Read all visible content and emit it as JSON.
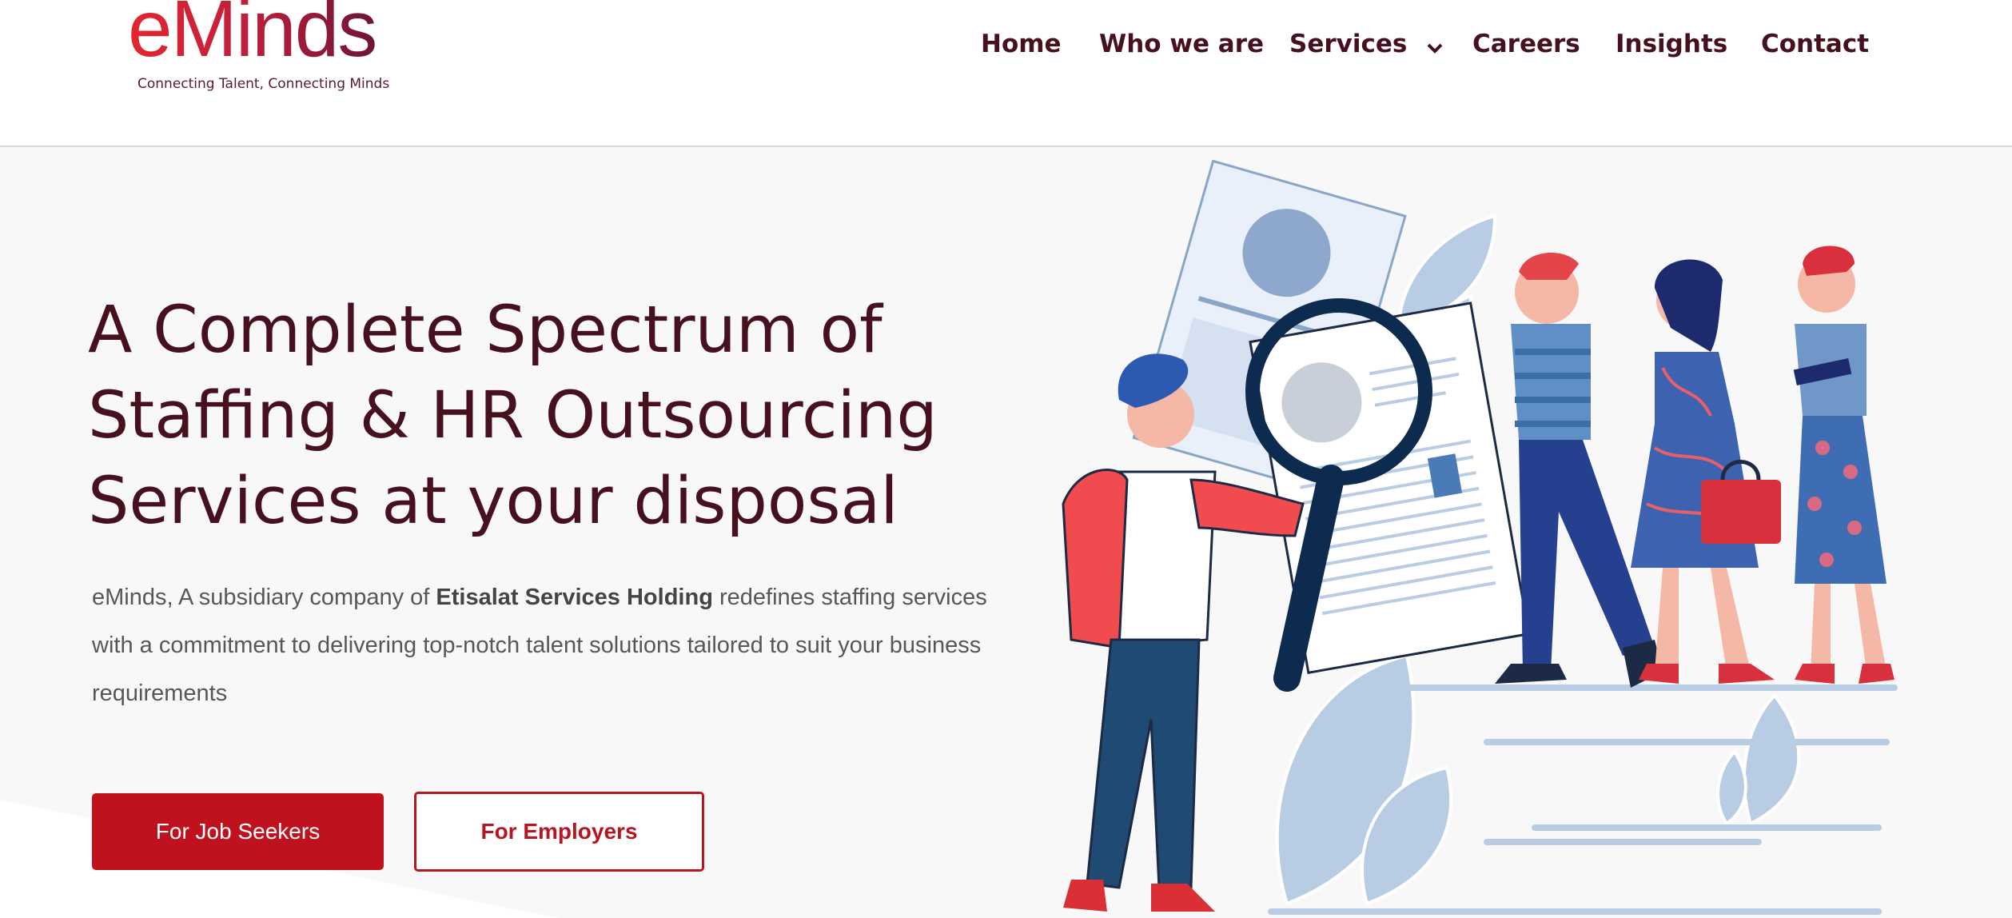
{
  "brand": {
    "name": "eMinds",
    "tagline": "Connecting Talent, Connecting Minds",
    "colors": {
      "primary_red": "#c0111f",
      "dark_maroon": "#47101f",
      "illustration_blue": "#b8cde4"
    }
  },
  "nav": {
    "items": [
      {
        "label": "Home"
      },
      {
        "label": "Who we are"
      },
      {
        "label": "Services",
        "icon": "chevron-down-icon"
      },
      {
        "label": "Careers"
      },
      {
        "label": "Insights"
      },
      {
        "label": "Contact"
      }
    ]
  },
  "hero": {
    "title_lines": [
      "A Complete Spectrum of",
      "Staffing & HR Outsourcing",
      "Services at your disposal"
    ],
    "description": {
      "prefix": "eMinds, A subsidiary company of ",
      "bold": "Etisalat Services Holding",
      "suffix": " redefines staffing services with a commitment to delivering top-notch talent solutions tailored to suit your business requirements"
    },
    "buttons": {
      "job_seekers": "For Job Seekers",
      "employers": "For Employers"
    },
    "illustration": "recruitment-illustration-magnifier-resume-people"
  }
}
